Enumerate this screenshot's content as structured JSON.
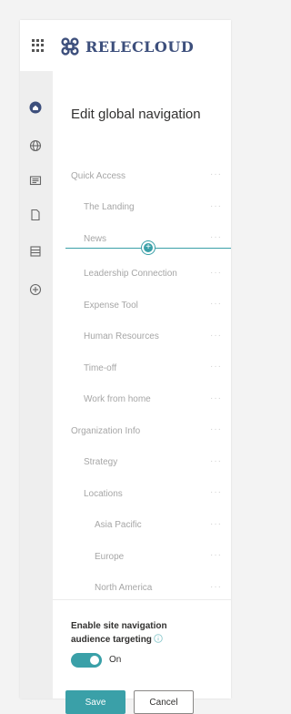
{
  "brand": {
    "name": "RELECLOUD",
    "accent": "#3d4f7c"
  },
  "rail": {
    "icons": [
      "home-icon",
      "globe-icon",
      "news-icon",
      "page-icon",
      "list-icon",
      "add-icon"
    ]
  },
  "panel": {
    "title": "Edit global navigation",
    "nav_items": [
      {
        "label": "Quick Access",
        "level": 0
      },
      {
        "label": "The Landing",
        "level": 1
      },
      {
        "label": "News",
        "level": 1
      },
      {
        "label": "Leadership Connection",
        "level": 1
      },
      {
        "label": "Expense Tool",
        "level": 1
      },
      {
        "label": "Human Resources",
        "level": 1
      },
      {
        "label": "Time-off",
        "level": 1
      },
      {
        "label": "Work from home",
        "level": 1
      },
      {
        "label": "Organization Info",
        "level": 0
      },
      {
        "label": "Strategy",
        "level": 1
      },
      {
        "label": "Locations",
        "level": 1
      },
      {
        "label": "Asia Pacific",
        "level": 2
      },
      {
        "label": "Europe",
        "level": 2
      },
      {
        "label": "North America",
        "level": 2
      }
    ],
    "more_glyph": "···",
    "insert_glyph": "+",
    "audience_label": "Enable site navigation audience targeting",
    "toggle_label": "On",
    "toggle_on": true,
    "save_label": "Save",
    "cancel_label": "Cancel",
    "accent": "#3aa0a8"
  }
}
